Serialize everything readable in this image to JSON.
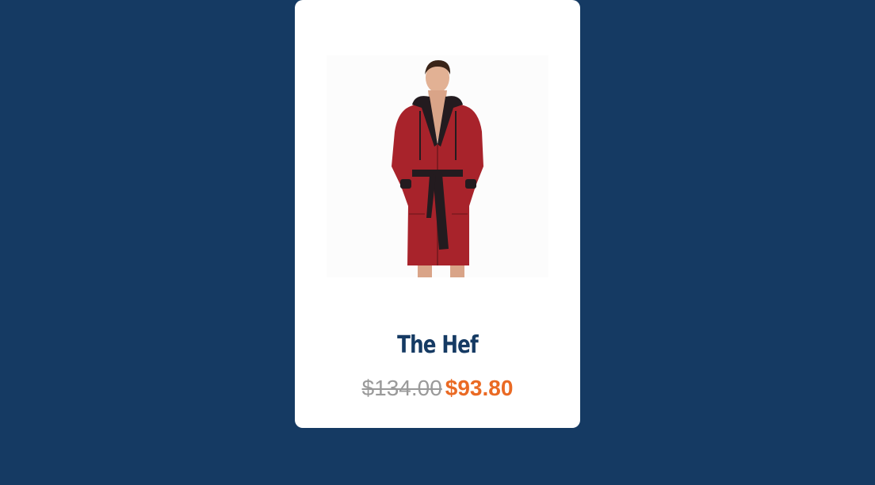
{
  "product": {
    "name": "The Hef",
    "original_price": "$134.00",
    "sale_price": "$93.80",
    "image_alt": "Man wearing red hooded bathrobe with black trim and belt"
  },
  "colors": {
    "background": "#153a63",
    "card": "#ffffff",
    "title": "#153a63",
    "original_price": "#9a9a9a",
    "sale_price": "#ea6a24",
    "robe": "#a8232b",
    "robe_trim": "#231b1f"
  }
}
